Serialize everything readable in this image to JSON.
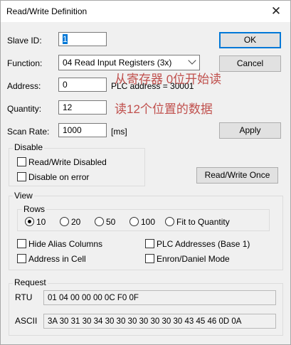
{
  "window": {
    "title": "Read/Write Definition"
  },
  "icons": {
    "close": "close-icon"
  },
  "slave_id": {
    "label": "Slave ID:",
    "value": "1"
  },
  "function": {
    "label": "Function:",
    "value": "04 Read Input Registers (3x)"
  },
  "address": {
    "label": "Address:",
    "value": "0",
    "plc_address": "PLC address = 30001"
  },
  "quantity": {
    "label": "Quantity:",
    "value": "12"
  },
  "scan_rate": {
    "label": "Scan Rate:",
    "value": "1000",
    "unit": "[ms]"
  },
  "annotations": {
    "address_note": "从寄存器 0位开始读",
    "quantity_note": "读12个位置的数据"
  },
  "buttons": {
    "ok": "OK",
    "cancel": "Cancel",
    "apply": "Apply",
    "read_write_once": "Read/Write Once"
  },
  "disable": {
    "title": "Disable",
    "read_write_disabled": "Read/Write Disabled",
    "disable_on_error": "Disable on error"
  },
  "view": {
    "title": "View",
    "rows_title": "Rows",
    "rows_options": [
      "10",
      "20",
      "50",
      "100",
      "Fit to Quantity"
    ],
    "rows_selected": "10",
    "hide_alias": "Hide Alias Columns",
    "plc_addresses": "PLC Addresses (Base 1)",
    "address_in_cell": "Address in Cell",
    "enron": "Enron/Daniel Mode"
  },
  "request": {
    "title": "Request",
    "rtu_label": "RTU",
    "rtu_value": "01 04 00 00 00 0C F0 0F",
    "ascii_label": "ASCII",
    "ascii_value": "3A 30 31 30 34 30 30 30 30 30 30 30 43 45 46 0D 0A"
  },
  "colors": {
    "annotation": "#c0504d",
    "accent": "#0078d7"
  }
}
